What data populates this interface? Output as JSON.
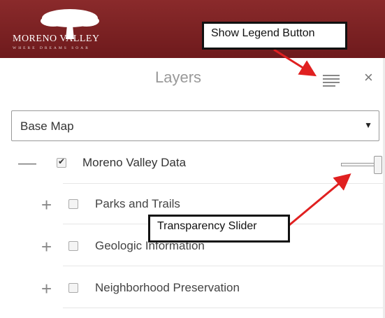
{
  "header": {
    "logo_name": "MORENO VALLEY",
    "logo_tagline": "WHERE DREAMS SOAR",
    "background_color": "#7a2022"
  },
  "panel": {
    "title": "Layers",
    "legend_icon": "list-lines-icon",
    "close_glyph": "×"
  },
  "basemap_select": {
    "value": "Base Map",
    "arrow": "▼"
  },
  "layers": [
    {
      "toggle": "—",
      "checked": true,
      "label": "Moreno Valley Data"
    },
    {
      "toggle": "+",
      "checked": false,
      "label": "Parks and Trails"
    },
    {
      "toggle": "+",
      "checked": false,
      "label": "Geologic Information"
    },
    {
      "toggle": "+",
      "checked": false,
      "label": "Neighborhood Preservation"
    }
  ],
  "transparency_slider": {
    "value": 1.0
  },
  "annotations": {
    "legend_callout": "Show Legend Button",
    "slider_callout": "Transparency Slider",
    "arrow_color": "#e02020"
  }
}
